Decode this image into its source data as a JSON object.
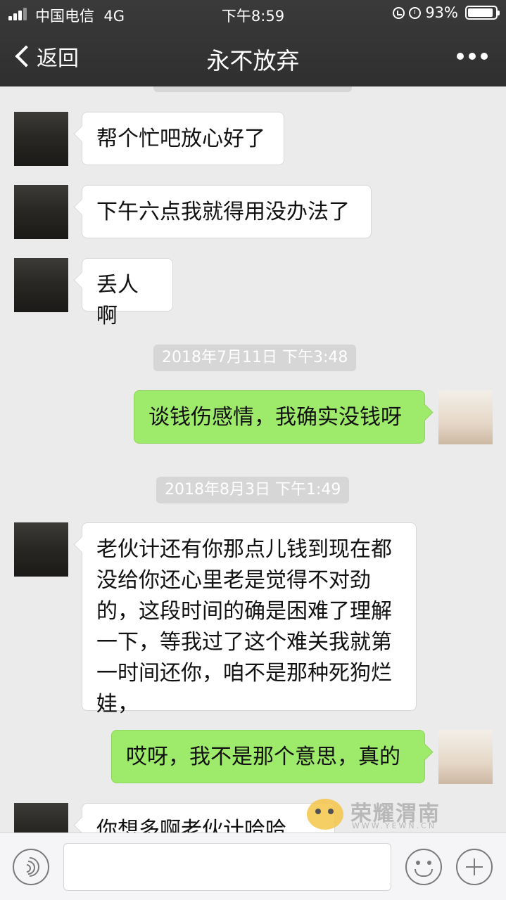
{
  "status_bar": {
    "carrier": "中国电信",
    "network": "4G",
    "time": "下午8:59",
    "battery_text": "93%",
    "battery_level": 0.93
  },
  "nav": {
    "back_label": "返回",
    "title": "永不放弃",
    "more_icon": "ellipsis-icon"
  },
  "messages": [
    {
      "side": "left",
      "text": "帮个忙吧放心好了"
    },
    {
      "side": "left",
      "text": "下午六点我就得用没办法了"
    },
    {
      "side": "left",
      "text": "丢人啊"
    },
    {
      "timestamp": "2018年7月11日 下午3:48"
    },
    {
      "side": "right",
      "text": "谈钱伤感情，我确实没钱呀"
    },
    {
      "timestamp": "2018年8月3日 下午1:49"
    },
    {
      "side": "left",
      "lines": [
        "老伙计还有你那点儿钱到现在都",
        "没给你还心里老是觉得不对劲",
        "的，这段时间的确是困难了理解",
        "一下，等我过了这个难关我就第",
        "一时间还你，咱不是那种死狗烂",
        "娃，"
      ]
    },
    {
      "side": "right",
      "text": "哎呀，我不是那个意思，真的"
    },
    {
      "side": "left",
      "text": "你想多啊老伙计哈哈"
    }
  ],
  "watermark": {
    "text": "荣耀渭南",
    "sub": "WWW.YEWN.CN"
  },
  "input_bar": {
    "voice_icon": "voice-icon",
    "emoji_icon": "emoji-icon",
    "plus_icon": "plus-icon"
  },
  "colors": {
    "nav_bg": "#2f2f2f",
    "chat_bg": "#ebebeb",
    "outgoing_bubble": "#9eea6a",
    "incoming_bubble": "#ffffff",
    "timestamp_bg": "#d6d6d6"
  }
}
